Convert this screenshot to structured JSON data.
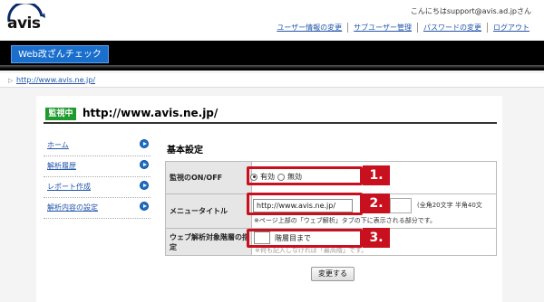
{
  "header": {
    "logo_text": "avis",
    "greeting": "こんにちはsupport@avis.ad.jpさん",
    "links": [
      "ユーザー情報の変更",
      "サブユーザー管理",
      "パスワードの変更",
      "ログアウト"
    ],
    "app_tab": "Web改ざんチェック"
  },
  "breadcrumb": {
    "url": "http://www.avis.ne.jp/"
  },
  "page": {
    "status_badge": "監視中",
    "site_url": "http://www.avis.ne.jp/"
  },
  "sidebar": {
    "items": [
      "ホーム",
      "解析履歴",
      "レポート作成",
      "解析内容の設定"
    ]
  },
  "settings": {
    "section_title": "基本設定",
    "monitor_label": "監視のON/OFF",
    "radio_on": "有効",
    "radio_off": "無効",
    "menu_title_label": "メニュータイトル",
    "menu_title_value": "http://www.avis.ne.jp/",
    "char_limit_note": "(全角20文字 半角40文",
    "menu_title_help": "※ページ上部の「ウェブ解析」タブの下に表示される部分です。",
    "depth_label": "ウェブ解析対象階層の指定",
    "depth_unit": "階層目まで",
    "depth_help": "※何も記入しなければ「最高階」です。",
    "submit_label": "変更する"
  },
  "callouts": [
    "1.",
    "2.",
    "3."
  ],
  "colors": {
    "header_band": "#000000",
    "app_tab": "#1b6fcc",
    "status_badge": "#1f9a2e",
    "callout_red": "#c8101e",
    "link_blue": "#2255aa"
  }
}
